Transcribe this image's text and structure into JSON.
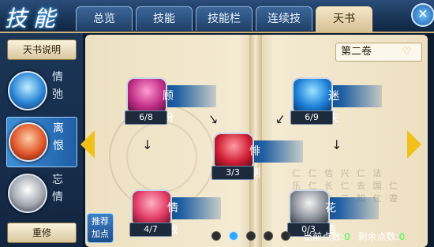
{
  "header": {
    "logo_text": "技能",
    "tabs": [
      "总览",
      "技能",
      "技能栏",
      "连续技",
      "天书"
    ],
    "active_tab_index": 4,
    "close_icon": "close-icon"
  },
  "sidebar": {
    "book_desc_label": "天书说明",
    "categories": [
      {
        "label": "情\n弛",
        "icon": "lotus-icon",
        "active": false
      },
      {
        "label": "离\n恨",
        "icon": "flame-icon",
        "active": true
      },
      {
        "label": "忘\n情",
        "icon": "skull-icon",
        "active": false
      }
    ],
    "reset_label": "重修"
  },
  "book": {
    "volume_label": "第二卷",
    "scripture_text": "仁 仁 信 兴 仁 法\n乐 仁 长 仁 去 国 仁\n夫 仁 仁 三 知 仁 遊",
    "nodes": [
      {
        "name": "顾盼",
        "count": "6/8",
        "icon": "pink-orb-icon",
        "icon_class": "ic-pink"
      },
      {
        "name": "迷失",
        "count": "6/9",
        "icon": "blue-orb-icon",
        "icon_class": "ic-blue"
      },
      {
        "name": "悱恻",
        "count": "3/3",
        "icon": "red-orb-icon",
        "icon_class": "ic-red"
      },
      {
        "name": "情致",
        "count": "4/7",
        "icon": "rose-orb-icon",
        "icon_class": "ic-rose"
      },
      {
        "name": "花情",
        "count": "0/3",
        "icon": "silver-orb-icon",
        "icon_class": "ic-silver"
      }
    ]
  },
  "footer": {
    "recommend_label": "推荐\n加点",
    "page_count": 5,
    "active_page_index": 1,
    "current_points_label": "当前点数:",
    "current_points_value": "0",
    "remaining_points_label": "剩余点数:",
    "remaining_points_value": "0"
  },
  "colors": {
    "accent": "#f0c11a",
    "points_value": "#4cff4c",
    "tab_active": "#f4e7c5"
  }
}
